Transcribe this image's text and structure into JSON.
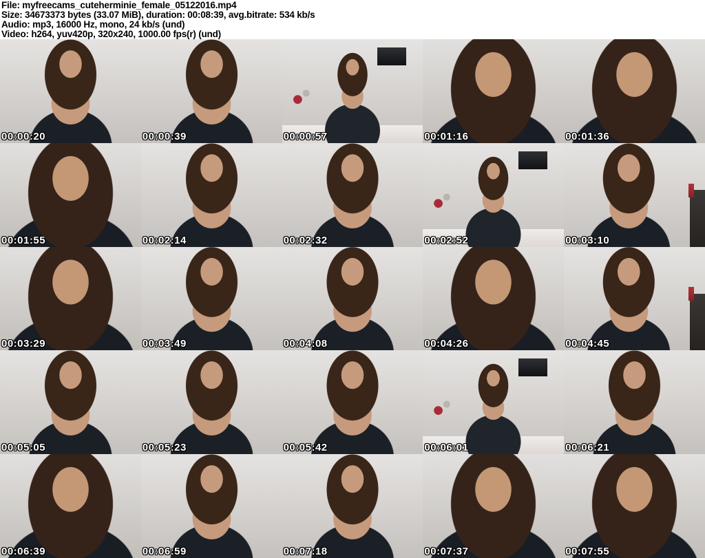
{
  "header": {
    "lines": [
      "File: myfreecams_cuteherminie_female_05122016.mp4",
      "Size: 34673373 bytes (33.07 MiB), duration: 00:08:39, avg.bitrate: 534 kb/s",
      "Audio: mp3, 16000 Hz, mono, 24 kb/s (und)",
      "Video: h264, yuv420p, 320x240, 1000.00 fps(r) (und)"
    ]
  },
  "grid": {
    "columns": 5,
    "rows": 5,
    "thumbnails": [
      {
        "timestamp": "00:00:20"
      },
      {
        "timestamp": "00:00:39"
      },
      {
        "timestamp": "00:00:57"
      },
      {
        "timestamp": "00:01:16"
      },
      {
        "timestamp": "00:01:36"
      },
      {
        "timestamp": "00:01:55"
      },
      {
        "timestamp": "00:02:14"
      },
      {
        "timestamp": "00:02:32"
      },
      {
        "timestamp": "00:02:52"
      },
      {
        "timestamp": "00:03:10"
      },
      {
        "timestamp": "00:03:29"
      },
      {
        "timestamp": "00:03:49"
      },
      {
        "timestamp": "00:04:08"
      },
      {
        "timestamp": "00:04:26"
      },
      {
        "timestamp": "00:04:45"
      },
      {
        "timestamp": "00:05:05"
      },
      {
        "timestamp": "00:05:23"
      },
      {
        "timestamp": "00:05:42"
      },
      {
        "timestamp": "00:06:01"
      },
      {
        "timestamp": "00:06:21"
      },
      {
        "timestamp": "00:06:39"
      },
      {
        "timestamp": "00:06:59"
      },
      {
        "timestamp": "00:07:18"
      },
      {
        "timestamp": "00:07:37"
      },
      {
        "timestamp": "00:07:55"
      }
    ]
  },
  "colors": {
    "background": "#ffffff",
    "header_text": "#000000",
    "timestamp_text": "#ffffff",
    "timestamp_outline": "#000000"
  }
}
